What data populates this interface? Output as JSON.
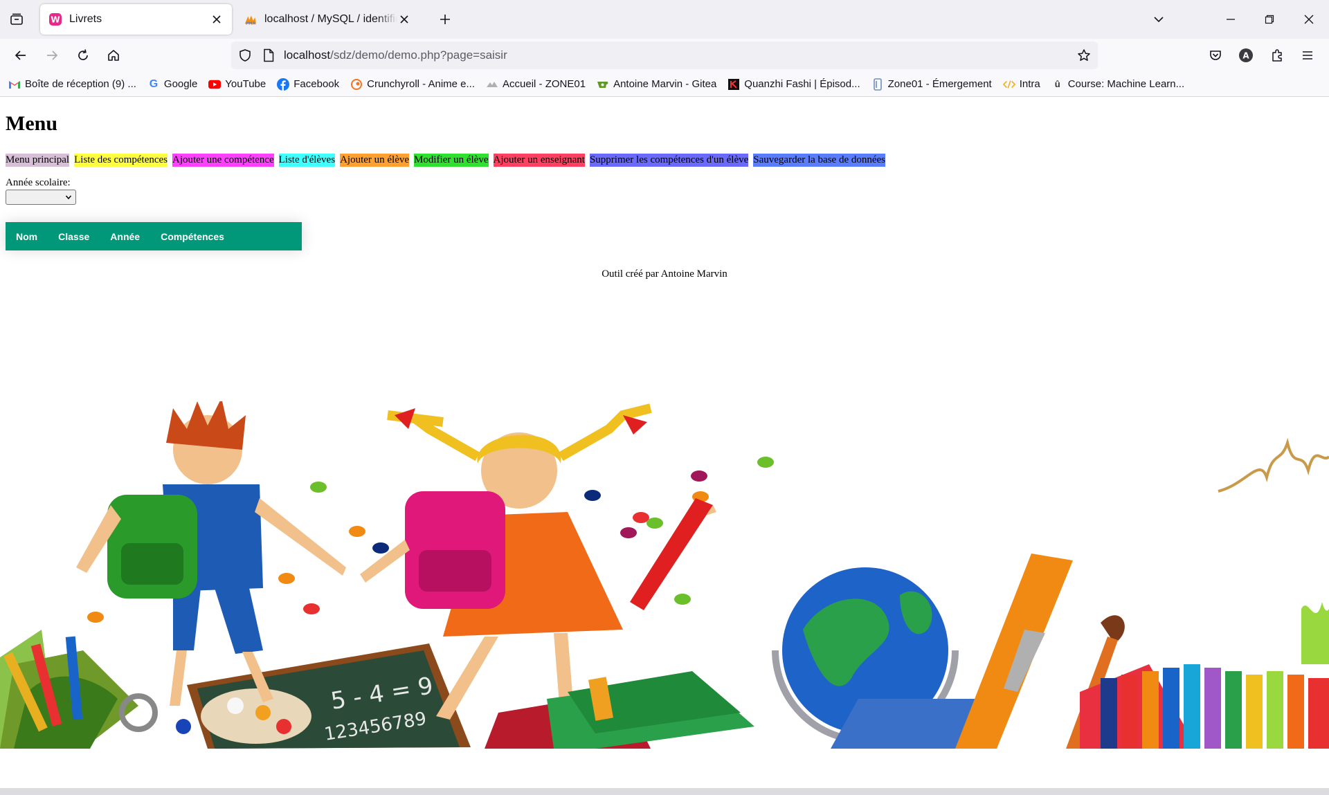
{
  "browser": {
    "tabs": [
      {
        "title": "Livrets",
        "active": true,
        "favicon": "livrets-favicon"
      },
      {
        "title": "localhost / MySQL / identification",
        "active": false,
        "favicon": "phpmyadmin-favicon"
      }
    ],
    "url": {
      "host": "localhost",
      "path": "/sdz/demo/demo.php?page=saisir"
    },
    "bookmarks": [
      {
        "label": "Boîte de réception (9) ...",
        "icon": "gmail-icon",
        "color": "#ea4335"
      },
      {
        "label": "Google",
        "icon": "google-icon",
        "color": "#4285f4"
      },
      {
        "label": "YouTube",
        "icon": "youtube-icon",
        "color": "#ff0000"
      },
      {
        "label": "Facebook",
        "icon": "facebook-icon",
        "color": "#1877f2"
      },
      {
        "label": "Crunchyroll - Anime e...",
        "icon": "crunchyroll-icon",
        "color": "#f47521"
      },
      {
        "label": "Accueil - ZONE01",
        "icon": "zone01-icon",
        "color": "#999999"
      },
      {
        "label": "Antoine Marvin - Gitea",
        "icon": "gitea-icon",
        "color": "#609926"
      },
      {
        "label": "Quanzhi Fashi | Épisod...",
        "icon": "quanzhi-icon",
        "color": "#111111"
      },
      {
        "label": "Zone01 - Émergement",
        "icon": "zone01-emergement-icon",
        "color": "#6c8ebf"
      },
      {
        "label": "Intra",
        "icon": "code-icon",
        "color": "#f2b01e"
      },
      {
        "label": "Course: Machine Learn...",
        "icon": "course-icon",
        "color": "#333333"
      }
    ]
  },
  "page": {
    "title": "Menu",
    "menu": [
      {
        "label": "Menu principal",
        "bg": "#d8bfd8"
      },
      {
        "label": "Liste des compétences",
        "bg": "#ffff40"
      },
      {
        "label": "Ajouter une compétence",
        "bg": "#ff40ff"
      },
      {
        "label": "Liste d'élèves",
        "bg": "#40ffff"
      },
      {
        "label": "Ajouter un élève",
        "bg": "#ffa030"
      },
      {
        "label": "Modifier un élève",
        "bg": "#30e030"
      },
      {
        "label": "Ajouter un enseignant",
        "bg": "#ff4060"
      },
      {
        "label": "Supprimer les compétences d'un élève",
        "bg": "#6a6aff"
      },
      {
        "label": "Sauvegarder la base de données",
        "bg": "#5a7dff"
      }
    ],
    "year_label": "Année scolaire:",
    "year_value": "",
    "table": {
      "columns": [
        "Nom",
        "Classe",
        "Année",
        "Compétences"
      ],
      "header_bg": "#009879"
    },
    "footer": "Outil créé par Antoine Marvin"
  }
}
